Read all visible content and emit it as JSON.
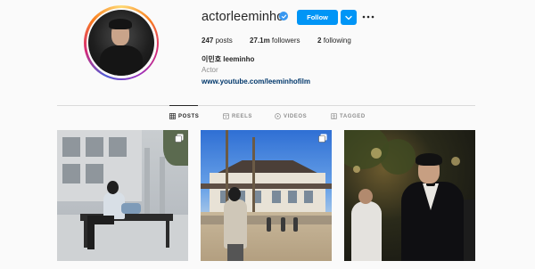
{
  "profile": {
    "username": "actorleeminho",
    "verified": true,
    "follow_label": "Follow",
    "stats": {
      "posts_count": "247",
      "posts_label": "posts",
      "followers_count": "27.1m",
      "followers_label": "followers",
      "following_count": "2",
      "following_label": "following"
    },
    "full_name": "이민호 leeminho",
    "category": "Actor",
    "link": "www.youtube.com/leeminhofilm"
  },
  "tabs": [
    {
      "label": "POSTS",
      "icon": "grid-icon",
      "active": true
    },
    {
      "label": "REELS",
      "icon": "reels-icon",
      "active": false
    },
    {
      "label": "VIDEOS",
      "icon": "video-play-icon",
      "active": false
    },
    {
      "label": "TAGGED",
      "icon": "tagged-icon",
      "active": false
    }
  ],
  "posts": [
    {
      "icon": "multiple-photos-icon"
    },
    {
      "icon": "multiple-photos-icon"
    },
    {
      "icon": ""
    }
  ],
  "colors": {
    "accent": "#0095f6",
    "verified": "#3897f0",
    "link": "#00376b",
    "muted": "#8e8e8e",
    "background": "#fafafa"
  }
}
